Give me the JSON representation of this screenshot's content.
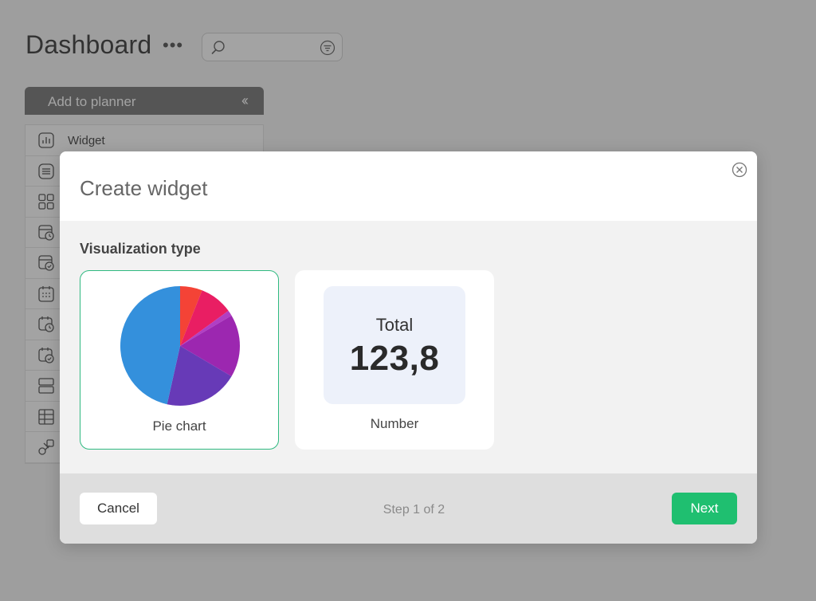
{
  "header": {
    "title": "Dashboard",
    "more_label": "•••",
    "search": {
      "value": "",
      "placeholder": ""
    }
  },
  "planner": {
    "title": "Add to planner",
    "collapse_icon": "double-chevron-left-icon",
    "items": [
      {
        "label": "Widget",
        "icon": "bar-chart-icon"
      },
      {
        "label": "",
        "icon": "list-icon"
      },
      {
        "label": "",
        "icon": "grid-icon"
      },
      {
        "label": "",
        "icon": "calendar-clock-icon"
      },
      {
        "label": "",
        "icon": "calendar-check-icon"
      },
      {
        "label": "",
        "icon": "calendar-icon"
      },
      {
        "label": "",
        "icon": "calendar-clock-icon"
      },
      {
        "label": "",
        "icon": "calendar-check-icon"
      },
      {
        "label": "",
        "icon": "rows-icon"
      },
      {
        "label": "",
        "icon": "table-icon"
      },
      {
        "label": "",
        "icon": "shapes-icon"
      }
    ]
  },
  "modal": {
    "title": "Create widget",
    "section_label": "Visualization type",
    "options": [
      {
        "label": "Pie chart",
        "selected": true
      },
      {
        "label": "Number",
        "selected": false
      }
    ],
    "number_preview": {
      "label": "Total",
      "value": "123,8"
    },
    "cancel_label": "Cancel",
    "step_text": "Step 1 of 2",
    "next_label": "Next"
  },
  "colors": {
    "accent": "#1fbf70",
    "selected_border": "#2fb980",
    "pie": [
      "#f44336",
      "#e91e63",
      "#9c27b0",
      "#9c27b0",
      "#673ab7",
      "#3490dc"
    ]
  },
  "chart_data": {
    "type": "pie",
    "values": [
      6,
      9,
      1.5,
      17,
      20,
      46.5
    ],
    "colors": [
      "#f44336",
      "#e91e63",
      "#b03fc4",
      "#9c27b0",
      "#673ab7",
      "#3490dc"
    ]
  }
}
